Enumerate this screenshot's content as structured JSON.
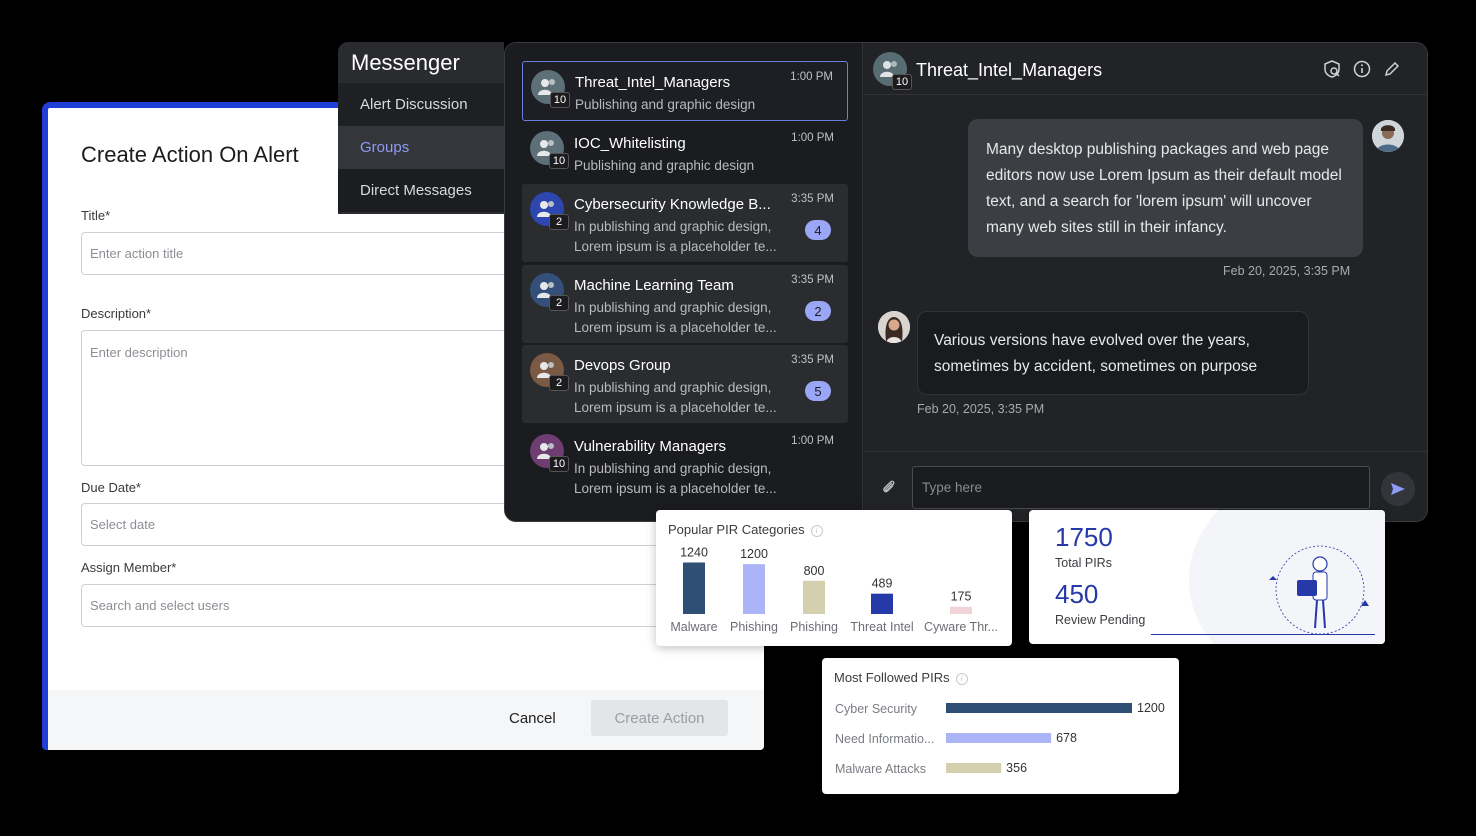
{
  "form": {
    "title": "Create Action On Alert",
    "title_label": "Title*",
    "title_placeholder": "Enter action title",
    "description_label": "Description*",
    "description_placeholder": "Enter description",
    "due_label": "Due Date*",
    "due_placeholder": "Select date",
    "assign_label": "Assign Member*",
    "assign_placeholder": "Search and select users",
    "cancel": "Cancel",
    "create": "Create Action",
    "accent": "#1f3fd6"
  },
  "messenger": {
    "title": "Messenger",
    "tabs": [
      {
        "label": "Alert Discussion"
      },
      {
        "label": "Groups"
      },
      {
        "label": "Direct Messages"
      }
    ],
    "active_tab": "Groups",
    "conversations": [
      {
        "name": "Threat_Intel_Managers",
        "preview1": "Publishing and graphic design",
        "preview2": "",
        "time": "1:00 PM",
        "members": "10",
        "unread": "",
        "avatar_color": "#5d6f77"
      },
      {
        "name": "IOC_Whitelisting",
        "preview1": "Publishing and graphic design",
        "preview2": "",
        "time": "1:00 PM",
        "members": "10",
        "unread": "",
        "avatar_color": "#5d6f77"
      },
      {
        "name": "Cybersecurity Knowledge B...",
        "preview1": "In publishing and graphic design,",
        "preview2": "Lorem ipsum is a placeholder te...",
        "time": "3:35 PM",
        "members": "2",
        "unread": "4",
        "avatar_color": "#2e47b0"
      },
      {
        "name": "Machine Learning Team",
        "preview1": "In publishing and graphic design,",
        "preview2": "Lorem ipsum is a placeholder te...",
        "time": "3:35 PM",
        "members": "2",
        "unread": "2",
        "avatar_color": "#34507a"
      },
      {
        "name": "Devops Group",
        "preview1": "In publishing and graphic design,",
        "preview2": "Lorem ipsum is a placeholder te...",
        "time": "3:35 PM",
        "members": "2",
        "unread": "5",
        "avatar_color": "#7a5a44"
      },
      {
        "name": "Vulnerability Managers",
        "preview1": "In publishing and graphic design,",
        "preview2": "Lorem ipsum is a placeholder te...",
        "time": "1:00 PM",
        "members": "10",
        "unread": "",
        "avatar_color": "#6e3d72"
      }
    ],
    "chat": {
      "title": "Threat_Intel_Managers",
      "members": "10",
      "messages": [
        {
          "text": "Many desktop publishing packages and web page editors now use Lorem Ipsum as their default model text, and a search for 'lorem ipsum' will uncover many web sites still in their infancy.",
          "time": "Feb 20, 2025, 3:35 PM",
          "direction": "outgoing"
        },
        {
          "text": "Various versions have evolved over the years, sometimes by accident, sometimes on purpose",
          "time": "Feb 20, 2025, 3:35 PM",
          "direction": "incoming"
        }
      ],
      "input_placeholder": "Type here"
    }
  },
  "popular_pir": {
    "title": "Popular PIR Categories",
    "chart_data": {
      "type": "bar",
      "categories": [
        "Malware",
        "Phishing",
        "Phishing",
        "Threat Intel",
        "Cyware Thr..."
      ],
      "values": [
        1240,
        1200,
        800,
        489,
        175
      ],
      "colors": [
        "#2f4f75",
        "#aab4f6",
        "#d4cfae",
        "#2539a8",
        "#f0d4da"
      ]
    }
  },
  "totals": {
    "total_value": "1750",
    "total_label": "Total PIRs",
    "pending_value": "450",
    "pending_label": "Review Pending"
  },
  "most_followed": {
    "title": "Most Followed PIRs",
    "chart_data": {
      "type": "bar",
      "orientation": "horizontal",
      "categories": [
        "Cyber Security",
        "Need Informatio...",
        "Malware Attacks"
      ],
      "values": [
        1200,
        678,
        356
      ],
      "colors": [
        "#2f4f75",
        "#aab4f6",
        "#d4cfae"
      ]
    }
  }
}
